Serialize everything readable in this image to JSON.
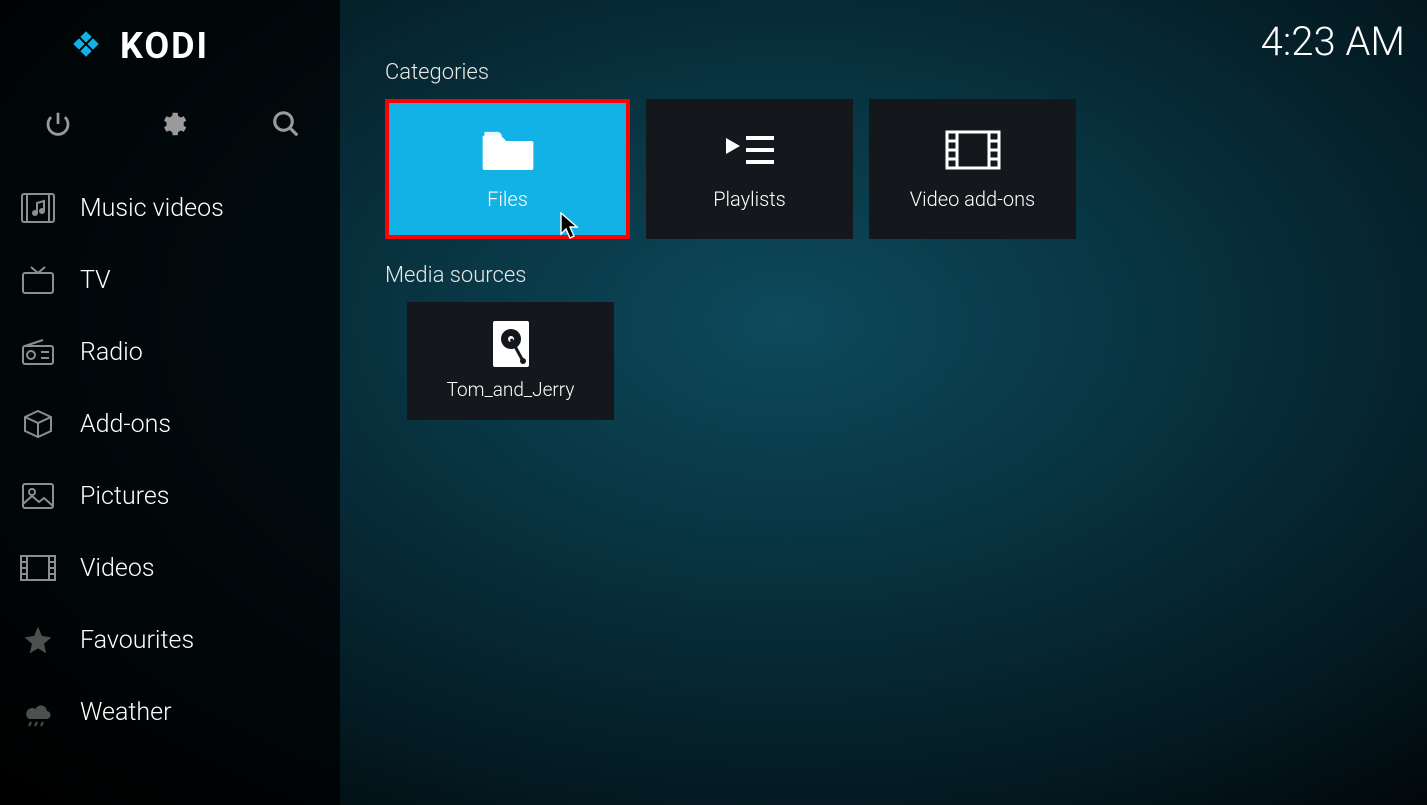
{
  "app_name": "KODI",
  "clock": "4:23 AM",
  "sidebar": {
    "items": [
      {
        "label": "Music videos",
        "icon": "music-video"
      },
      {
        "label": "TV",
        "icon": "tv"
      },
      {
        "label": "Radio",
        "icon": "radio"
      },
      {
        "label": "Add-ons",
        "icon": "box"
      },
      {
        "label": "Pictures",
        "icon": "picture"
      },
      {
        "label": "Videos",
        "icon": "film"
      },
      {
        "label": "Favourites",
        "icon": "star"
      },
      {
        "label": "Weather",
        "icon": "weather"
      }
    ]
  },
  "main": {
    "categories_title": "Categories",
    "categories": [
      {
        "label": "Files",
        "icon": "folder",
        "selected": true
      },
      {
        "label": "Playlists",
        "icon": "playlist",
        "selected": false
      },
      {
        "label": "Video add-ons",
        "icon": "film",
        "selected": false
      }
    ],
    "sources_title": "Media sources",
    "sources": [
      {
        "label": "Tom_and_Jerry",
        "icon": "hdd"
      }
    ]
  }
}
